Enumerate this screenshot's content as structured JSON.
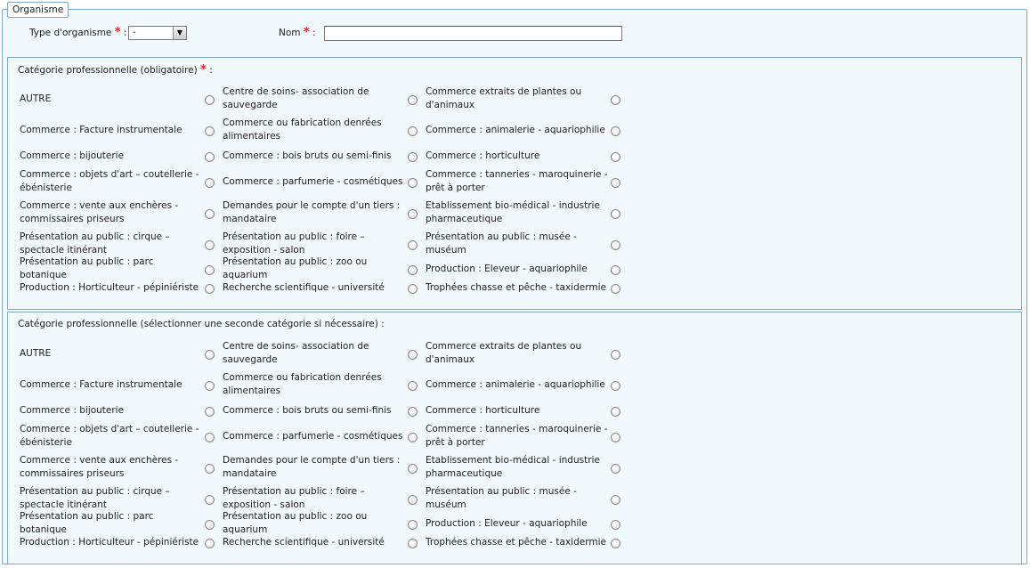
{
  "organisme": {
    "legend": "Organisme",
    "type_label": "Type d'organisme",
    "type_value": "-",
    "nom_label": "Nom",
    "nom_value": "",
    "colon": ":",
    "required_mark": "*"
  },
  "categories_primary": {
    "title": "Catégorie professionnelle (obligatoire)",
    "colon": ":",
    "options": [
      [
        "AUTRE",
        "Centre de soins- association de sauvegarde",
        "Commerce extraits de plantes ou d'animaux"
      ],
      [
        "Commerce : Facture instrumentale",
        "Commerce ou fabrication denrées alimentaires",
        "Commerce  : animalerie - aquariophilie"
      ],
      [
        "Commerce  : bijouterie",
        "Commerce  : bois bruts ou semi-finis",
        "Commerce  : horticulture"
      ],
      [
        "Commerce  : objets d'art – coutellerie - ébénisterie",
        "Commerce  : parfumerie - cosmétiques",
        "Commerce  : tanneries - maroquinerie - prêt à porter"
      ],
      [
        "Commerce  : vente aux enchères - commissaires priseurs",
        "Demandes pour le compte d'un tiers : mandataire",
        "Etablissement bio-médical - industrie pharmaceutique"
      ],
      [
        "Présentation au public  : cirque – spectacle itinérant",
        "Présentation au public  : foire – exposition - salon",
        "Présentation au public  : musée - muséum"
      ],
      [
        "Présentation au public  : parc botanique",
        "Présentation au public  : zoo ou aquarium",
        "Production : Eleveur - aquariophile"
      ],
      [
        "Production : Horticulteur - pépiniériste",
        "Recherche scientifique - université",
        "Trophées chasse et pêche - taxidermie"
      ]
    ]
  },
  "categories_secondary": {
    "title": "Catégorie professionnelle (sélectionner une seconde catégorie si nécessaire) :",
    "options": [
      [
        "AUTRE",
        "Centre de soins- association de sauvegarde",
        "Commerce extraits de plantes ou d'animaux"
      ],
      [
        "Commerce : Facture instrumentale",
        "Commerce ou fabrication denrées alimentaires",
        "Commerce  : animalerie - aquariophilie"
      ],
      [
        "Commerce  : bijouterie",
        "Commerce  : bois bruts ou semi-finis",
        "Commerce  : horticulture"
      ],
      [
        "Commerce  : objets d'art – coutellerie - ébénisterie",
        "Commerce  : parfumerie - cosmétiques",
        "Commerce  : tanneries - maroquinerie - prêt à porter"
      ],
      [
        "Commerce  : vente aux enchères - commissaires priseurs",
        "Demandes pour le compte d'un tiers : mandataire",
        "Etablissement bio-médical - industrie pharmaceutique"
      ],
      [
        "Présentation au public  : cirque – spectacle itinérant",
        "Présentation au public  : foire – exposition - salon",
        "Présentation au public  : musée - muséum"
      ],
      [
        "Présentation au public  : parc botanique",
        "Présentation au public  : zoo ou aquarium",
        "Production : Eleveur - aquariophile"
      ],
      [
        "Production : Horticulteur - pépiniériste",
        "Recherche scientifique - université",
        "Trophées chasse et pêche - taxidermie"
      ]
    ]
  },
  "icons": {
    "select_arrow": "chevron-down-icon"
  }
}
